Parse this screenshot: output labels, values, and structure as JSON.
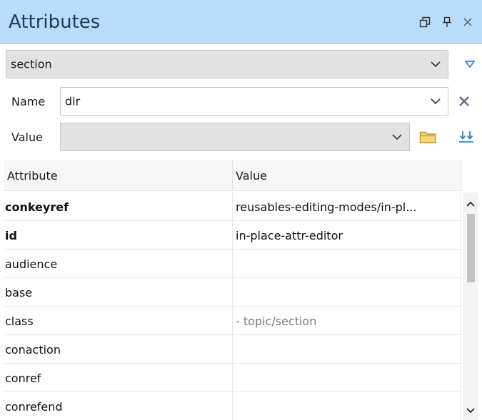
{
  "panel": {
    "title": "Attributes",
    "restore_icon": "restore-window-icon",
    "pin_icon": "pin-icon",
    "close_icon": "close-icon"
  },
  "element_selector": {
    "value": "section",
    "filter_icon": "filter-triangle-icon"
  },
  "name_field": {
    "label": "Name",
    "value": "dir",
    "remove_icon": "remove-x-icon"
  },
  "value_field": {
    "label": "Value",
    "value": "",
    "browse_icon": "folder-icon",
    "apply_icon": "apply-down-arrows-icon"
  },
  "grid": {
    "columns": [
      "Attribute",
      "Value"
    ],
    "rows": [
      {
        "attribute": "conkeyref",
        "value": "reusables-editing-modes/in-pl...",
        "bold": true,
        "muted": false
      },
      {
        "attribute": "id",
        "value": "in-place-attr-editor",
        "bold": true,
        "muted": false
      },
      {
        "attribute": "audience",
        "value": "",
        "bold": false,
        "muted": false
      },
      {
        "attribute": "base",
        "value": "",
        "bold": false,
        "muted": false
      },
      {
        "attribute": "class",
        "value": "- topic/section",
        "bold": false,
        "muted": true
      },
      {
        "attribute": "conaction",
        "value": "",
        "bold": false,
        "muted": false
      },
      {
        "attribute": "conref",
        "value": "",
        "bold": false,
        "muted": false
      },
      {
        "attribute": "conrefend",
        "value": "",
        "bold": false,
        "muted": false
      }
    ]
  },
  "colors": {
    "titlebar_bg": "#b9dcf8",
    "accent_blue": "#3a7fc4",
    "folder_yellow": "#e8b93a"
  }
}
